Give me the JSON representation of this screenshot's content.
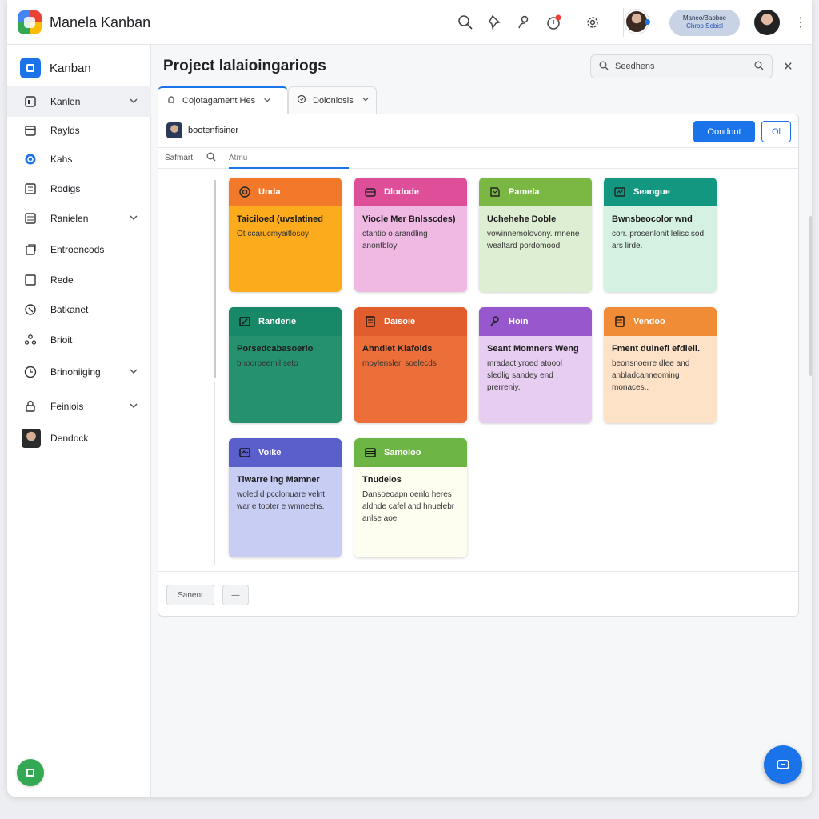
{
  "app": {
    "title": "Manela Kanban"
  },
  "header": {
    "user_pill": {
      "line1": "Maneo/Baoboe",
      "line2": "Chrop Sebisl"
    },
    "icons": [
      "search-icon",
      "pin-icon",
      "person-icon",
      "notification-icon",
      "settings-icon"
    ]
  },
  "sidebar": {
    "heading": "Kanban",
    "items": [
      {
        "label": "Kanlen",
        "icon": "board-icon",
        "chevron": true,
        "active": true
      },
      {
        "label": "Raylds",
        "icon": "calendar-icon"
      },
      {
        "label": "Kahs",
        "icon": "circle-icon"
      },
      {
        "label": "Rodigs",
        "icon": "grid-icon"
      },
      {
        "label": "Ranielen",
        "icon": "list-icon",
        "chevron": true
      },
      {
        "label": "Entroencods",
        "icon": "copy-icon"
      },
      {
        "label": "Rede",
        "icon": "square-icon"
      },
      {
        "label": "Batkanet",
        "icon": "tag-icon"
      },
      {
        "label": "Brioit",
        "icon": "people-icon"
      },
      {
        "label": "Brinohiiging",
        "icon": "clock-icon",
        "chevron": true
      },
      {
        "label": "Feiniois",
        "icon": "lock-icon",
        "chevron": true
      },
      {
        "label": "Dendock",
        "icon": "avatar"
      }
    ]
  },
  "main": {
    "title": "Project lalaioingariogs",
    "search_placeholder": "Seedhens",
    "tabs": [
      {
        "label": "Cojotagament Hes"
      },
      {
        "label": "Dolonlosis"
      }
    ],
    "project_name": "bootenfisiner",
    "primary_button": "Oondoot",
    "secondary_button": "Ol",
    "filter_label": "Safmart",
    "filter_field": "Atmu",
    "footer_buttons": [
      "Sanent",
      "—"
    ]
  },
  "cards": [
    {
      "head": "Unda",
      "title": "Taiciloed (uvslatined",
      "desc": "Ot ccarucmyaitlosoy",
      "head_color": "#f2792a",
      "body_color": "#fbab1c",
      "icon": "target-icon"
    },
    {
      "head": "Dlodode",
      "title": "Viocle Mer Bnlsscdes)",
      "desc": "ctantio o arandling anontbloy",
      "head_color": "#df4e98",
      "body_color": "#efb9e4",
      "icon": "box-icon"
    },
    {
      "head": "Pamela",
      "title": "Uchehehe Doble",
      "desc": "vowinnemolovony. rnnene wealtard pordomood.",
      "head_color": "#7ab843",
      "body_color": "#ddeed2",
      "icon": "book-icon"
    },
    {
      "head": "Seangue",
      "title": "Bwnsbeocolor wnd",
      "desc": "corr. prosenlonit lelisc sod ars lirde.",
      "head_color": "#139780",
      "body_color": "#d4f1e2",
      "icon": "chart-icon"
    },
    {
      "head": "Randerie",
      "title": "Porsedcabasoerlo",
      "desc": "bnoorpeemil seto",
      "head_color": "#178868",
      "body_color": "#26916f",
      "icon": "edit-icon"
    },
    {
      "head": "Daisoie",
      "title": "Ahndlet Klafolds",
      "desc": "moylensleri soelecds",
      "head_color": "#e15d2e",
      "body_color": "#ec6f3a",
      "icon": "doc-icon"
    },
    {
      "head": "Hoin",
      "title": "Seant Momners Weng",
      "desc": "mradact yroed atoool sledlig sandey end prerreniy.",
      "head_color": "#9658cc",
      "body_color": "#e6cdf1",
      "icon": "user-icon"
    },
    {
      "head": "Vendoo",
      "title": "Fment dulnefl efdieli.",
      "desc": "beonsnoerre dlee and anbladcanneoming monaces..",
      "head_color": "#f08b36",
      "body_color": "#fde2c8",
      "icon": "doc-icon"
    },
    {
      "head": "Voike",
      "title": "Tiwarre ing Mamner",
      "desc": "woled d pcclonuare velnt war e tooter e wmneehs.",
      "head_color": "#5a5fcc",
      "body_color": "#c8cdf4",
      "icon": "folder-icon"
    },
    {
      "head": "Samoloo",
      "title": "Tnudelos",
      "desc": "Dansoeoapn oenlo heres aldnde cafel and hnuelebr anlse aoe",
      "head_color": "#6db544",
      "body_color": "#fdfdf0",
      "icon": "stack-icon"
    }
  ]
}
